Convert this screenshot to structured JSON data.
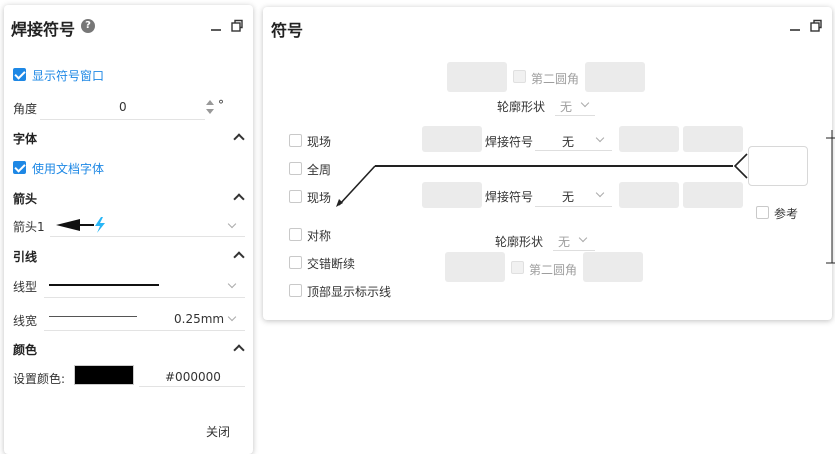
{
  "left_panel": {
    "title": "焊接符号",
    "help_icon": "?",
    "show_symbol_window": "显示符号窗口",
    "angle_label": "角度",
    "angle_value": "0",
    "angle_unit": "°",
    "font_section": "字体",
    "use_doc_font": "使用文档字体",
    "arrow_section": "箭头",
    "arrow_label": "箭头1",
    "leader_section": "引线",
    "line_type_label": "线型",
    "line_width_label": "线宽",
    "line_width_value": "0.25mm",
    "color_section": "颜色",
    "set_color_label": "设置颜色:",
    "color_value": "#000000",
    "close_label": "关闭"
  },
  "right_panel": {
    "title": "符号",
    "second_fillet_top": "第二圆角",
    "contour_top_label": "轮廓形状",
    "contour_top_value": "无",
    "site_top": "现场",
    "weld_symbol_top_label": "焊接符号",
    "weld_symbol_top_value": "无",
    "all_around": "全周",
    "site_bottom": "现场",
    "weld_symbol_bottom_label": "焊接符号",
    "weld_symbol_bottom_value": "无",
    "reference": "参考",
    "symmetric": "对称",
    "contour_bottom_label": "轮廓形状",
    "contour_bottom_value": "无",
    "staggered": "交错断续",
    "second_fillet_bottom": "第二圆角",
    "show_top_line": "顶部显示标示线"
  },
  "colors": {
    "accent": "#1e88e5",
    "arrow_bolt": "#29b6f6",
    "swatch": "#000000"
  }
}
